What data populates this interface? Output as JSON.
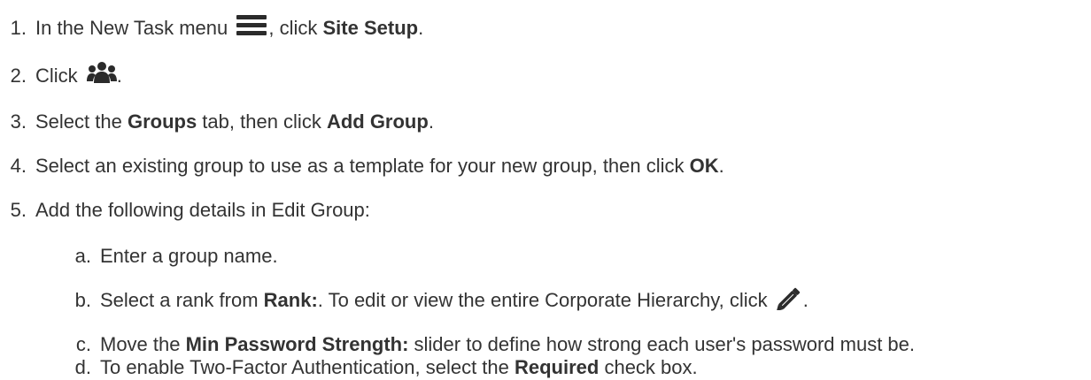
{
  "steps": [
    {
      "num": "1.",
      "pre": "In the New Task menu ",
      "icon": "hamburger-menu-icon",
      "post": ", click ",
      "bold": "Site Setup",
      "end": "."
    },
    {
      "num": "2.",
      "pre": "Click ",
      "icon": "users-group-icon",
      "end": "."
    },
    {
      "num": "3.",
      "pre": "Select the ",
      "bold1": "Groups",
      "mid": " tab, then click ",
      "bold2": "Add Group",
      "end": "."
    },
    {
      "num": "4.",
      "pre": "Select an existing group to use as a template for your new group, then click ",
      "bold": "OK",
      "end": "."
    },
    {
      "num": "5.",
      "text": "Add the following details in Edit Group:"
    }
  ],
  "substeps": [
    {
      "num": "a.",
      "text": "Enter a group name."
    },
    {
      "num": "b.",
      "pre": "Select a rank from ",
      "bold": "Rank:",
      "post": ". To edit or view the entire Corporate Hierarchy, click ",
      "icon": "pencil-edit-icon",
      "end": "."
    },
    {
      "num": "c.",
      "pre": "Move the ",
      "bold": "Min Password Strength:",
      "post": " slider to define how strong each user's password must be."
    },
    {
      "num": "d.",
      "pre": "To enable Two-Factor Authentication, select the ",
      "bold": "Required",
      "post": " check box."
    }
  ],
  "colors": {
    "text": "#333333",
    "icon": "#2b2b2b"
  }
}
